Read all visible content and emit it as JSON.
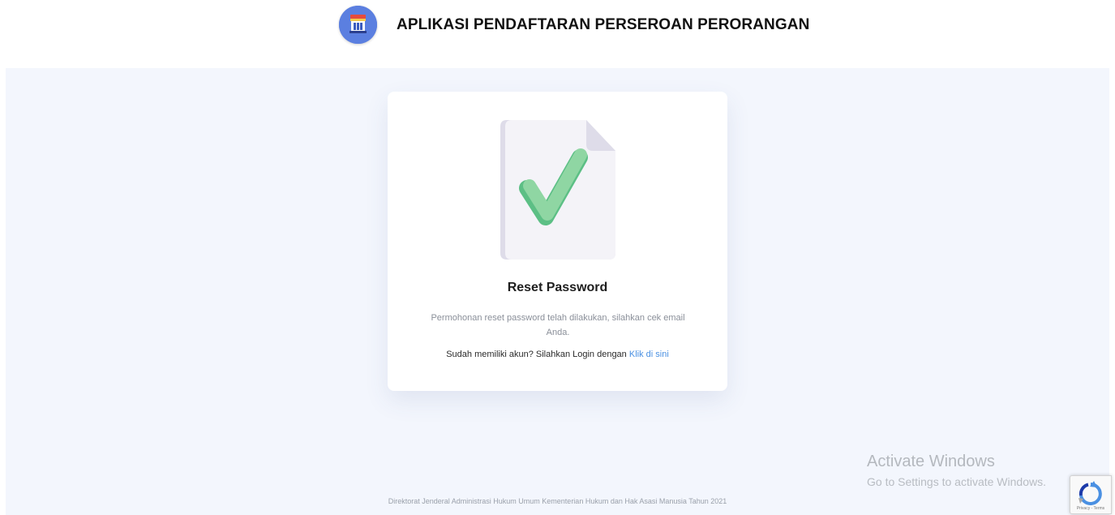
{
  "header": {
    "app_title": "APLIKASI PENDAFTARAN PERSEROAN PERORANGAN",
    "logo_icon": "ministry-emblem-icon"
  },
  "card": {
    "illustration_icon": "document-check-icon",
    "title": "Reset Password",
    "message": "Permohonan reset password telah dilakukan, silahkan cek email Anda.",
    "login_prompt": "Sudah memiliki akun? Silahkan Login dengan",
    "login_link": "Klik di sini"
  },
  "footer": {
    "text": "Direktorat Jenderal Administrasi Hukum Umum Kementerian Hukum dan Hak Asasi Manusia Tahun 2021"
  },
  "watermark": {
    "title": "Activate Windows",
    "subtitle": "Go to Settings to activate Windows."
  },
  "recaptcha": {
    "terms": "Privacy - Terms"
  },
  "colors": {
    "page_background": "#f3f6fd",
    "card_background": "#ffffff",
    "link": "#4a90e2",
    "check_green": "#8fd6a3",
    "logo_blue": "#5b7fe0"
  }
}
